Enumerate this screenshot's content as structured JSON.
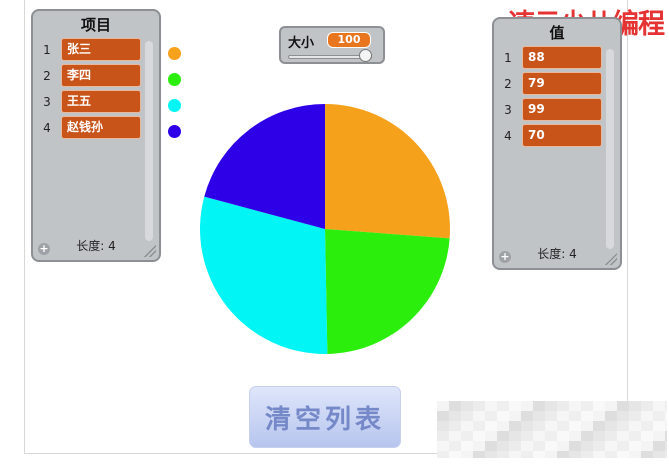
{
  "watermark": {
    "text": "速云少儿编程"
  },
  "left_list": {
    "title": "项目",
    "items": [
      {
        "index": "1",
        "value": "张三"
      },
      {
        "index": "2",
        "value": "李四"
      },
      {
        "index": "3",
        "value": "王五"
      },
      {
        "index": "4",
        "value": "赵钱孙"
      }
    ],
    "footer": "长度: 4",
    "add_symbol": "+"
  },
  "right_list": {
    "title": "值",
    "items": [
      {
        "index": "1",
        "value": "88"
      },
      {
        "index": "2",
        "value": "79"
      },
      {
        "index": "3",
        "value": "99"
      },
      {
        "index": "4",
        "value": "70"
      }
    ],
    "footer": "长度: 4",
    "add_symbol": "+"
  },
  "variable": {
    "label": "大小",
    "value": "100",
    "slider_fraction": 1.0
  },
  "legend": [
    {
      "color": "#f6a11c",
      "icon": "orange-dot"
    },
    {
      "color": "#2bee0c",
      "icon": "green-dot"
    },
    {
      "color": "#00f5f4",
      "icon": "cyan-dot"
    },
    {
      "color": "#2d00e8",
      "icon": "blue-dot"
    }
  ],
  "chart_data": {
    "type": "pie",
    "values": [
      88,
      79,
      99,
      70
    ],
    "categories": [
      "张三",
      "李四",
      "王五",
      "赵钱孙"
    ],
    "colors": [
      "#f6a11c",
      "#2bee0c",
      "#00f5f4",
      "#2d00e8"
    ],
    "start": "12 o'clock",
    "direction": "clockwise"
  },
  "clear_button": {
    "label": "清空列表"
  }
}
